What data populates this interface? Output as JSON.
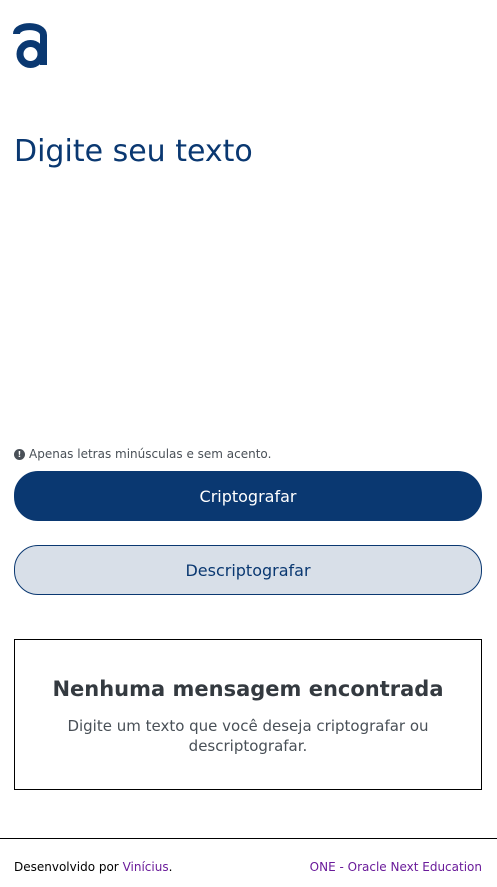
{
  "logo": {
    "icon": "alura-a-logo",
    "color": "#0A3871"
  },
  "input": {
    "placeholder": "Digite seu texto",
    "value": ""
  },
  "hint": {
    "icon": "exclamation-circle-icon",
    "text": "Apenas letras minúsculas e sem acento."
  },
  "buttons": {
    "encrypt_label": "Criptografar",
    "decrypt_label": "Descriptografar"
  },
  "output": {
    "title": "Nenhuma mensagem encontrada",
    "description": "Digite um texto que você deseja criptografar ou descriptografar."
  },
  "footer": {
    "credit_prefix": "Desenvolvido por ",
    "author": "Vinícius",
    "credit_suffix": ".",
    "program_link": "ONE - Oracle Next Education"
  },
  "colors": {
    "primary": "#0A3871",
    "secondary_bg": "#D8DFE8",
    "link": "#6A1B9A"
  }
}
